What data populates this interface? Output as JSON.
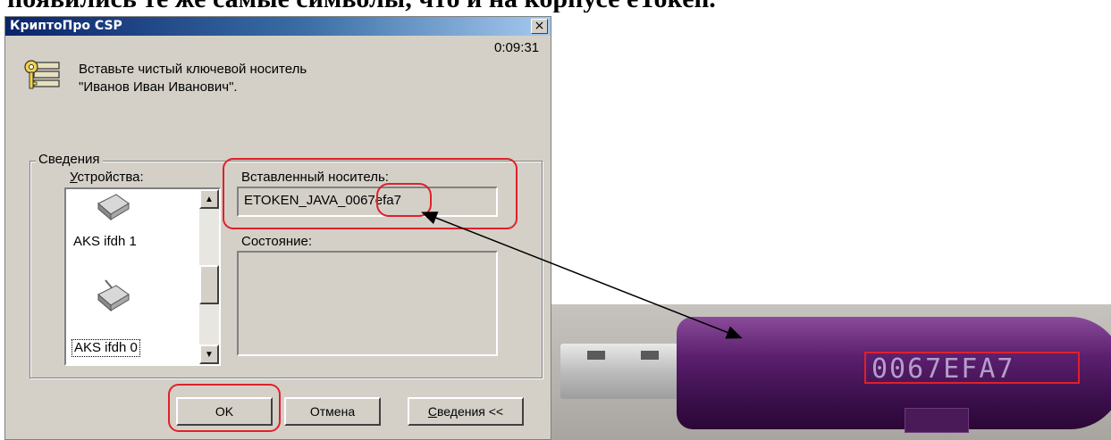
{
  "document": {
    "heading": "появились те же самые символы, что и на корпусе eToken."
  },
  "dialog": {
    "title": "КриптоПро CSP",
    "close_symbol": "×",
    "timer": "0:09:31",
    "message_line1": "Вставьте чистый ключевой носитель",
    "message_line2": "\"Иванов Иван Иванович\".",
    "group_label": "Сведения",
    "devices_label_mnemonic": "У",
    "devices_label_rest": "стройства:",
    "inserted_media_label": "Вставленный носитель:",
    "inserted_media_value": "ETOKEN_JAVA_0067efa7",
    "status_label": "Состояние:",
    "devices": [
      {
        "label": "AKS ifdh 1",
        "icon": "smartcard-reader-icon",
        "selected": false
      },
      {
        "label": "AKS ifdh 0",
        "icon": "smartcard-reader-icon",
        "selected": true
      }
    ],
    "buttons": {
      "ok": "OK",
      "cancel": "Отмена",
      "details_mnemonic": "С",
      "details_rest": "ведения <<"
    }
  },
  "token_photo": {
    "serial": "0067EFA7"
  },
  "colors": {
    "highlight": "#e0202a",
    "dialog_face": "#d4d0c8",
    "titlebar_start": "#0a246a",
    "token_body": "#5b1f6e"
  }
}
